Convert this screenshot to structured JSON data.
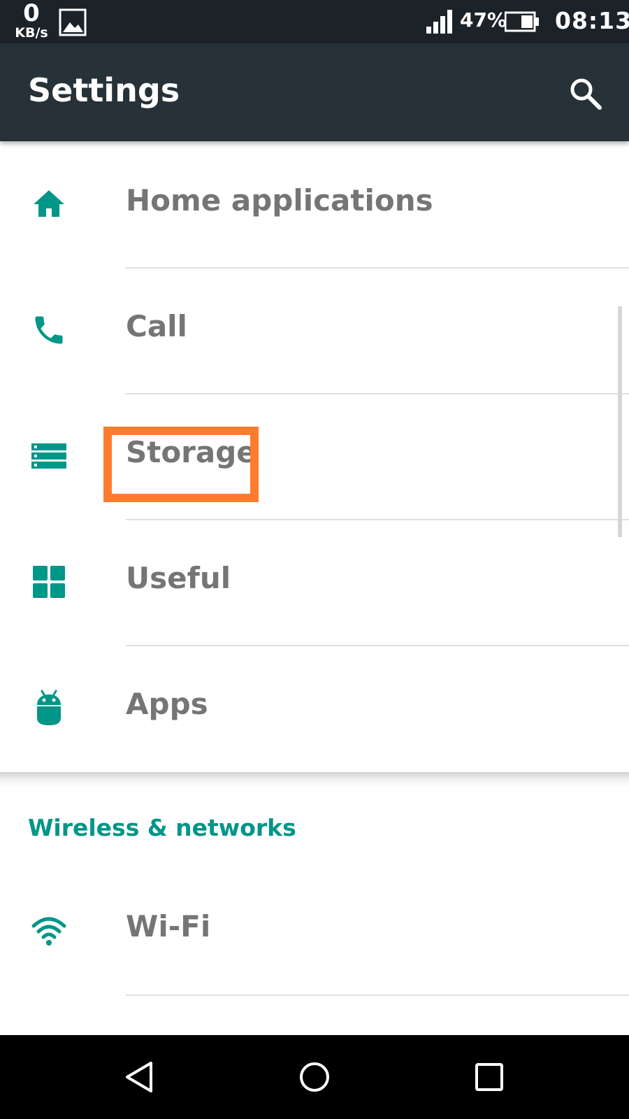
{
  "status_bar": {
    "net_value": "0",
    "net_unit": "KB/s",
    "battery_percent": "47%",
    "time": "08:13"
  },
  "toolbar": {
    "title": "Settings",
    "search_icon": "search-icon"
  },
  "items": [
    {
      "label": "Home applications",
      "icon": "home-icon"
    },
    {
      "label": "Call",
      "icon": "phone-icon"
    },
    {
      "label": "Storage",
      "icon": "storage-icon"
    },
    {
      "label": "Useful",
      "icon": "grid-icon"
    },
    {
      "label": "Apps",
      "icon": "android-icon"
    }
  ],
  "section": {
    "title": "Wireless & networks",
    "items": [
      {
        "label": "Wi-Fi",
        "icon": "wifi-icon"
      }
    ]
  },
  "highlight": {
    "target": "Storage",
    "color": "#ff7b2e"
  },
  "colors": {
    "accent": "#009688",
    "toolbar": "#263238",
    "status_bar": "#1c2328",
    "text": "#757575"
  },
  "nav_bar": {
    "buttons": [
      "back-icon",
      "home-circle-icon",
      "recents-icon"
    ]
  }
}
